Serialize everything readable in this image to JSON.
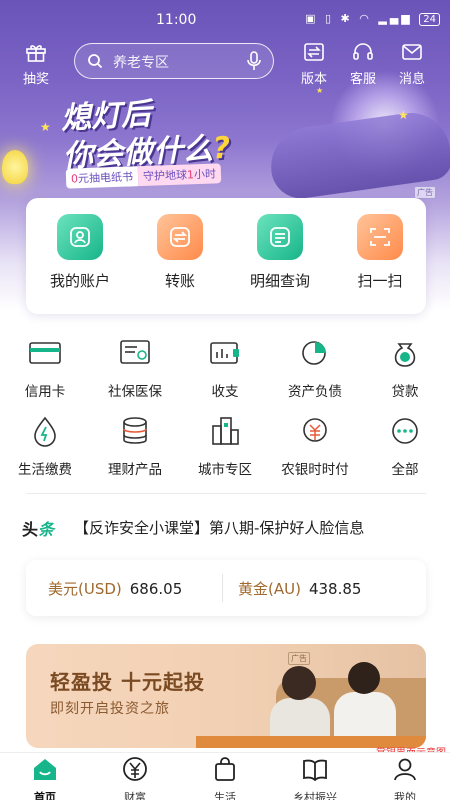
{
  "status_bar": {
    "time": "11:00",
    "battery": "24"
  },
  "header": {
    "left": {
      "label": "抽奖",
      "icon": "gift-icon"
    },
    "search": {
      "placeholder": "养老专区"
    },
    "right": [
      {
        "label": "版本",
        "icon": "switch-icon"
      },
      {
        "label": "客服",
        "icon": "headset-icon"
      },
      {
        "label": "消息",
        "icon": "mail-icon"
      }
    ]
  },
  "banner": {
    "title_line1": "熄灯后",
    "title_line2": "你会做什么",
    "title_q": "?",
    "sub_a_num": "0",
    "sub_a": "元抽电纸书",
    "sub_b": "守护地球",
    "sub_b_num": "1",
    "sub_b_tail": "小时",
    "ad": "广告"
  },
  "quick_actions": [
    {
      "label": "我的账户",
      "icon": "account-icon",
      "color": "#17b58a"
    },
    {
      "label": "转账",
      "icon": "transfer-icon",
      "color": "#ff8a4a"
    },
    {
      "label": "明细查询",
      "icon": "details-icon",
      "color": "#17b58a"
    },
    {
      "label": "扫一扫",
      "icon": "scan-icon",
      "color": "#ff8a4a"
    }
  ],
  "services": [
    {
      "label": "信用卡",
      "icon": "credit-card-icon"
    },
    {
      "label": "社保医保",
      "icon": "social-security-icon"
    },
    {
      "label": "收支",
      "icon": "income-expense-icon"
    },
    {
      "label": "资产负债",
      "icon": "pie-chart-icon"
    },
    {
      "label": "贷款",
      "icon": "loan-icon"
    },
    {
      "label": "生活缴费",
      "icon": "utility-icon"
    },
    {
      "label": "理财产品",
      "icon": "coins-icon"
    },
    {
      "label": "城市专区",
      "icon": "city-icon"
    },
    {
      "label": "农银时时付",
      "icon": "pay-icon"
    },
    {
      "label": "全部",
      "icon": "more-icon"
    }
  ],
  "news": {
    "tag_a": "头",
    "tag_b": "条",
    "text": "【反诈安全小课堂】第八期-保护好人脸信息"
  },
  "rates": [
    {
      "name": "美元(USD)",
      "value": "686.05"
    },
    {
      "name": "黄金(AU)",
      "value": "438.85"
    }
  ],
  "promo": {
    "title": "轻盈投  十元起投",
    "subtitle": "即刻开启投资之旅",
    "ad": "广告"
  },
  "watermark": "掌银界面示意图",
  "tabs": [
    {
      "label": "首页",
      "icon": "home-icon",
      "active": true
    },
    {
      "label": "财富",
      "icon": "yen-icon"
    },
    {
      "label": "生活",
      "icon": "bag-icon"
    },
    {
      "label": "乡村振兴",
      "icon": "book-icon"
    },
    {
      "label": "我的",
      "icon": "user-icon"
    }
  ],
  "colors": {
    "brand_green": "#17b58a",
    "accent_orange": "#ff8a4a",
    "banner_purple": "#6a54b8"
  }
}
